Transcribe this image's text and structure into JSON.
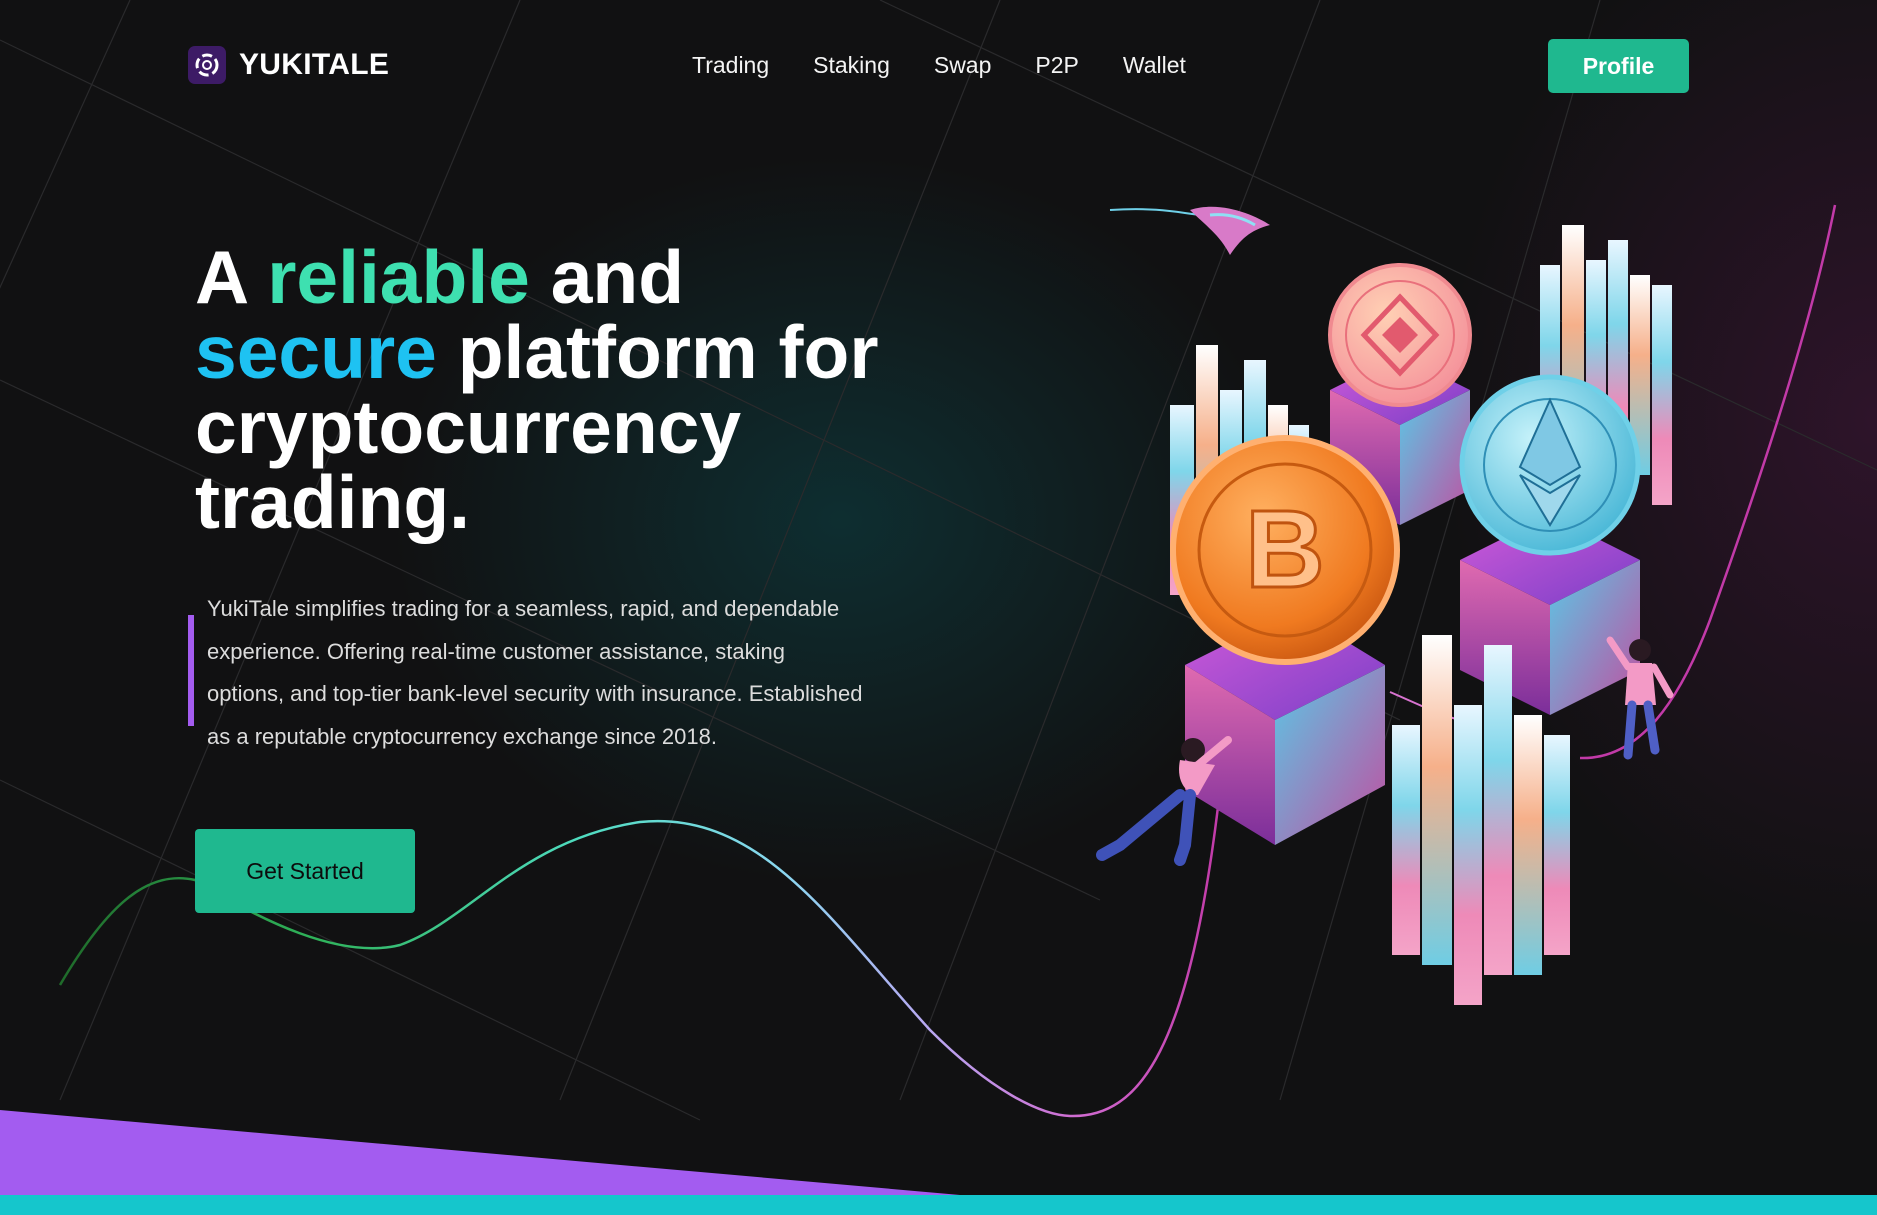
{
  "brand": {
    "name": "YUKITALE",
    "logo_icon": "yukitale-logo-icon"
  },
  "nav": {
    "items": [
      {
        "label": "Trading"
      },
      {
        "label": "Staking"
      },
      {
        "label": "Swap"
      },
      {
        "label": "P2P"
      },
      {
        "label": "Wallet"
      }
    ]
  },
  "header": {
    "profile_label": "Profile"
  },
  "hero": {
    "title_part1": "A ",
    "title_highlight1": "reliable",
    "title_part2": " and ",
    "title_highlight2": "secure",
    "title_part3": " platform for cryptocurrency trading.",
    "description": "YukiTale simplifies trading for a seamless, rapid, and dependable experience. Offering real-time customer assistance, staking options, and top-tier bank-level security with insurance. Established as a reputable cryptocurrency exchange since 2018.",
    "cta_label": "Get Started"
  },
  "illustration": {
    "coins": [
      {
        "name": "BITCOIN",
        "symbol": "B"
      },
      {
        "name": "BINANCE",
        "symbol": "◆"
      },
      {
        "name": "ETHEREUM",
        "symbol": "◆"
      }
    ]
  },
  "colors": {
    "accent_green": "#1fb88f",
    "highlight_green": "#3ee0b0",
    "highlight_blue": "#1ec2f2",
    "accent_purple": "#a45cf0",
    "background": "#111112"
  }
}
